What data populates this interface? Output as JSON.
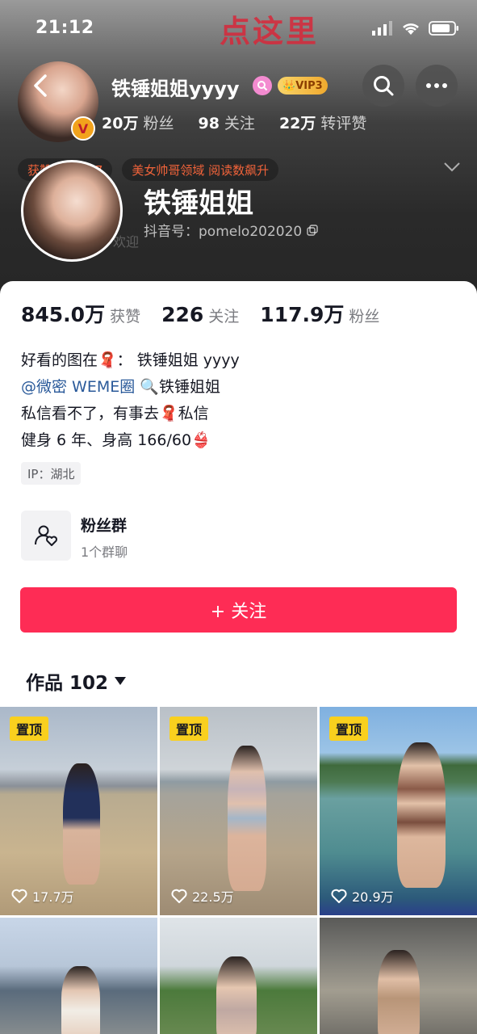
{
  "status_bar": {
    "time": "21:12"
  },
  "banner_text": "点这里",
  "nav": {
    "name": "铁锤姐姐yyyy",
    "vip_label": "VIP3",
    "v_badge": "V",
    "stats": [
      {
        "value": "20万",
        "label": "粉丝"
      },
      {
        "value": "98",
        "label": "关注"
      },
      {
        "value": "22万",
        "label": "转评赞"
      }
    ]
  },
  "tags": [
    "获赞超级...27",
    "美女帅哥领域 阅读数飙升"
  ],
  "profile": {
    "name": "铁锤姐姐",
    "douyin_id": "抖音号：pomelo202020",
    "faint_text": "欢迎"
  },
  "stats": [
    {
      "value": "845.0万",
      "label": "获赞"
    },
    {
      "value": "226",
      "label": "关注"
    },
    {
      "value": "117.9万",
      "label": "粉丝"
    }
  ],
  "bio": {
    "line1": "好看的图在🧣：  铁锤姐姐 yyyy",
    "line2_link": "@微密 WEME圈",
    "line2_rest": "🔍铁锤姐姐",
    "line3": "私信看不了，有事去🧣私信",
    "line4": "健身 6 年、身高 166/60👙"
  },
  "ip": "IP：湖北",
  "fan_group": {
    "title": "粉丝群",
    "subtitle": "1个群聊"
  },
  "follow_button": "+ 关注",
  "works_tab": {
    "label": "作品 102"
  },
  "videos": [
    {
      "pinned": "置顶",
      "likes": "17.7万"
    },
    {
      "pinned": "置顶",
      "likes": "22.5万"
    },
    {
      "pinned": "置顶",
      "likes": "20.9万"
    },
    {
      "pinned": "",
      "likes": ""
    },
    {
      "pinned": "",
      "likes": ""
    },
    {
      "pinned": "",
      "likes": ""
    }
  ],
  "colors": {
    "accent": "#fe2c55",
    "pin": "#f9d01e",
    "link": "#2a5a9a"
  }
}
